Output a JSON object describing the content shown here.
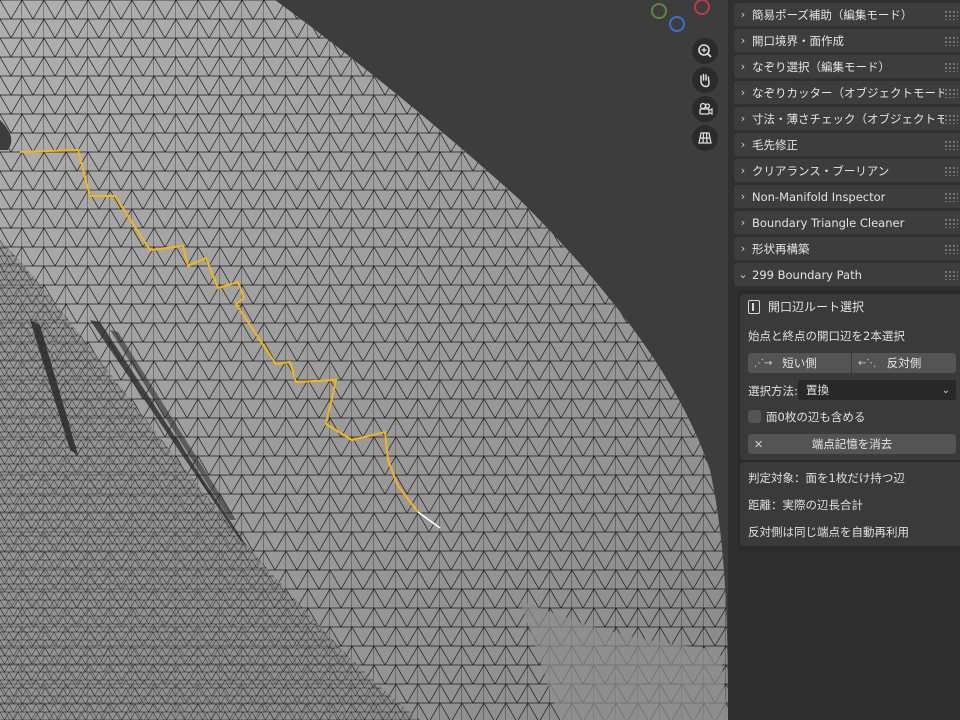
{
  "panels": [
    {
      "label": "簡易ポーズ補助（編集モード）",
      "expanded": false
    },
    {
      "label": "開口境界・面作成",
      "expanded": false
    },
    {
      "label": "なぞり選択（編集モード）",
      "expanded": false
    },
    {
      "label": "なぞりカッター（オブジェクトモード）",
      "expanded": false
    },
    {
      "label": "寸法・薄さチェック（オブジェクトモー",
      "expanded": false
    },
    {
      "label": "毛先修正",
      "expanded": false
    },
    {
      "label": "クリアランス・ブーリアン",
      "expanded": false
    },
    {
      "label": "Non-Manifold Inspector",
      "expanded": false
    },
    {
      "label": "Boundary Triangle Cleaner",
      "expanded": false
    },
    {
      "label": "形状再構築",
      "expanded": false
    },
    {
      "label": "299 Boundary Path",
      "expanded": true
    }
  ],
  "chevrons": {
    "collapsed": "›",
    "expanded": "⌄"
  },
  "boundary_path": {
    "subpanel_title": "開口辺ルート選択",
    "instruction": "始点と終点の開口辺を2本選択",
    "short_side_label": "短い側",
    "opposite_side_label": "反対側",
    "select_method_label": "選択方法:",
    "select_method_value": "置換",
    "include_zero_face_label": "面0枚の辺も含める",
    "include_zero_face_checked": false,
    "clear_memory_label": "端点記憶を消去",
    "info_target": "判定対象：面を1枚だけ持つ辺",
    "info_distance": "距離：実際の辺長合計",
    "info_reuse": "反対側は同じ端点を自動再利用"
  },
  "gizmo_colors": {
    "green": "#5d8a3a",
    "red": "#c0394a",
    "blue": "#3d6fc9"
  },
  "nav_icons": [
    "zoom-icon",
    "hand-pan-icon",
    "camera-icon",
    "grid-view-icon"
  ],
  "mesh_colors": {
    "surface": "#9a9a9a",
    "edge": "#1c1c1c",
    "selected_path": "#f2b619"
  }
}
